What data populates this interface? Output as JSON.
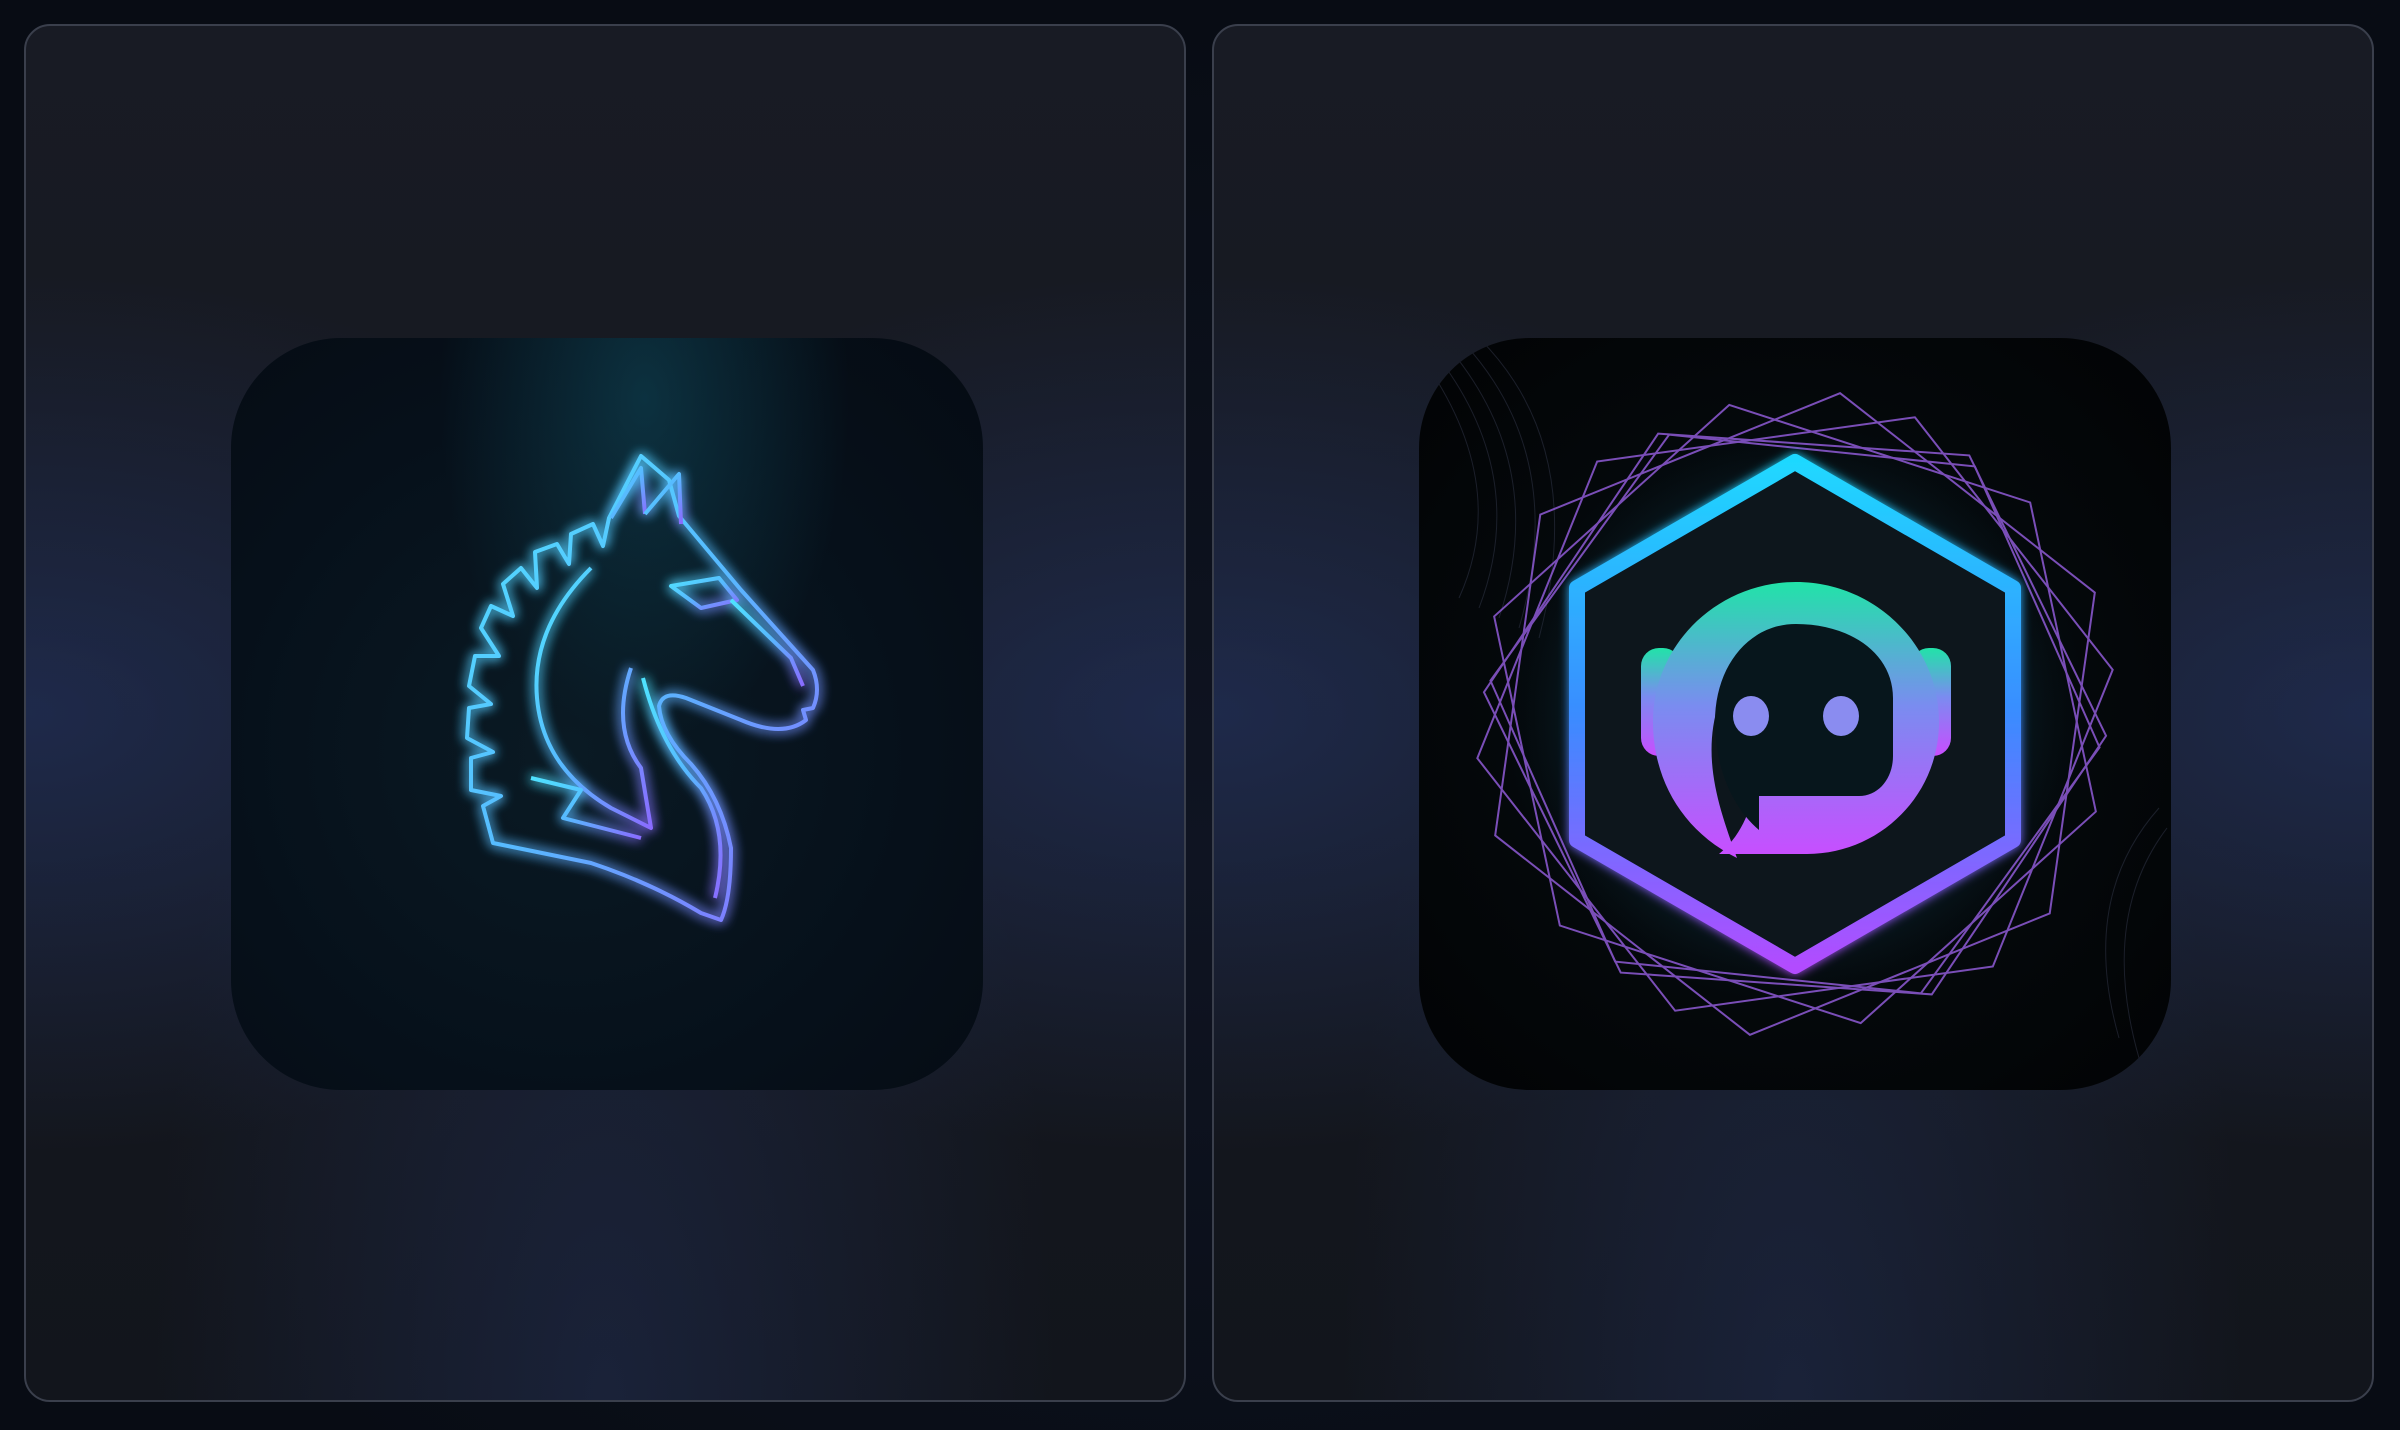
{
  "cards": [
    {
      "icon": "horse-head-icon",
      "accent": "#4fd9ff",
      "accent2": "#8a6bff"
    },
    {
      "icon": "robot-hexagon-icon",
      "accent": "#22d6f2",
      "accent2": "#c04bff"
    }
  ]
}
